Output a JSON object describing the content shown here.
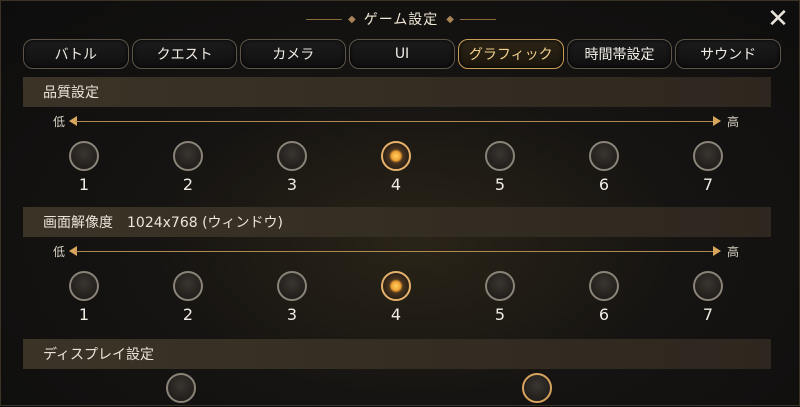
{
  "window": {
    "title": "ゲーム設定",
    "title_ornament": "◆"
  },
  "close_glyph": "✕",
  "tabs": [
    {
      "label": "バトル",
      "active": false
    },
    {
      "label": "クエスト",
      "active": false
    },
    {
      "label": "カメラ",
      "active": false
    },
    {
      "label": "UI",
      "active": false
    },
    {
      "label": "グラフィック",
      "active": true
    },
    {
      "label": "時間帯設定",
      "active": false
    },
    {
      "label": "サウンド",
      "active": false
    }
  ],
  "sections": {
    "quality": {
      "title": "品質設定",
      "low_label": "低",
      "high_label": "高",
      "options": [
        "1",
        "2",
        "3",
        "4",
        "5",
        "6",
        "7"
      ],
      "selected": "4"
    },
    "resolution": {
      "title": "画面解像度　1024x768 (ウィンドウ)",
      "low_label": "低",
      "high_label": "高",
      "options": [
        "1",
        "2",
        "3",
        "4",
        "5",
        "6",
        "7"
      ],
      "selected": "4"
    },
    "display": {
      "title": "ディスプレイ設定"
    }
  },
  "colors": {
    "accent": "#e5b16a",
    "selected_fill": "#ffcf63",
    "header_bg": "#3b3326"
  }
}
